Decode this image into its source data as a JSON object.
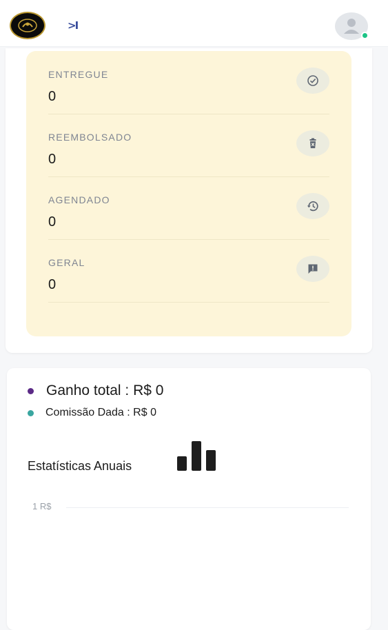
{
  "header": {
    "collapse_label": ">I",
    "icons": {
      "logo": "brand-emblem",
      "avatar": "user-avatar",
      "status": "online"
    },
    "colors": {
      "online": "#1cc486",
      "collapse": "#3a4e9c"
    }
  },
  "order_status": {
    "items": [
      {
        "label": "ENTREGUE",
        "value": "0",
        "icon": "check-circle-icon"
      },
      {
        "label": "REEMBOLSADO",
        "value": "0",
        "icon": "trash-x-icon"
      },
      {
        "label": "AGENDADO",
        "value": "0",
        "icon": "history-icon"
      },
      {
        "label": "GERAL",
        "value": "0",
        "icon": "message-icon"
      }
    ],
    "colors": {
      "panel": "#fdf5d9"
    }
  },
  "earnings": {
    "total_text": "Ganho total : R$ 0",
    "commission_text": "Comissão Dada : R$ 0",
    "colors": {
      "total_dot": "#5b2a86",
      "commission_dot": "#3aa6a0"
    },
    "annual_title": "Estatísticas Anuais",
    "annual_icon": "bar-chart-icon",
    "y_tick": "1 R$"
  }
}
